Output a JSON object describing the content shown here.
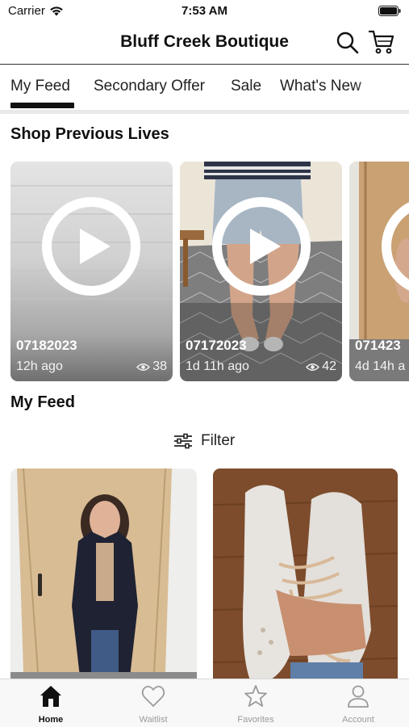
{
  "status_bar": {
    "carrier": "Carrier",
    "time": "7:53 AM"
  },
  "header": {
    "title": "Bluff Creek Boutique",
    "search_icon": "search-icon",
    "cart_icon": "cart-icon"
  },
  "tabs": [
    {
      "label": "My Feed",
      "active": true
    },
    {
      "label": "Secondary Offer"
    },
    {
      "label": "Sale"
    },
    {
      "label": "What's New"
    }
  ],
  "shop_previous_lives": {
    "title": "Shop Previous Lives",
    "items": [
      {
        "title": "07182023",
        "time": "12h ago",
        "views": "38"
      },
      {
        "title": "07172023",
        "time": "1d 11h ago",
        "views": "42"
      },
      {
        "title": "071423",
        "time": "4d 14h a"
      }
    ]
  },
  "my_feed": {
    "title": "My Feed",
    "filter_label": "Filter"
  },
  "bottom_nav": [
    {
      "label": "Home",
      "icon": "home-icon",
      "active": true
    },
    {
      "label": "Waitlist",
      "icon": "heart-icon"
    },
    {
      "label": "Favorites",
      "icon": "star-icon"
    },
    {
      "label": "Account",
      "icon": "person-icon"
    }
  ],
  "colors": {
    "accent": "#111111",
    "divider": "#e9e9ea",
    "nav_inactive": "#9a9a9a",
    "nav_bg": "#f8f8f8"
  }
}
